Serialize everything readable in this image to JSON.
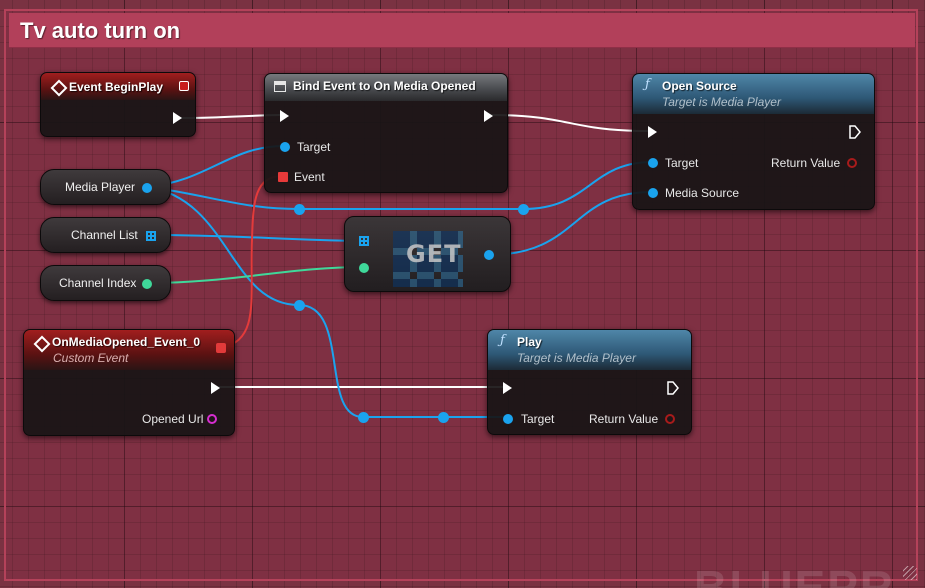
{
  "comment": {
    "title": "Tv auto turn on"
  },
  "watermark": "BLUEPR",
  "nodes": {
    "begin_play": {
      "title": "Event BeginPlay"
    },
    "bind_event": {
      "title": "Bind Event to On Media Opened",
      "pins": {
        "target": "Target",
        "event": "Event"
      }
    },
    "open_source": {
      "title": "Open Source",
      "subtitle": "Target is Media Player",
      "pins": {
        "target": "Target",
        "media_source": "Media Source",
        "return_value": "Return Value"
      }
    },
    "get": {
      "title": "GET"
    },
    "on_media_opened": {
      "title": "OnMediaOpened_Event_0",
      "subtitle": "Custom Event",
      "pins": {
        "opened_url": "Opened Url"
      }
    },
    "play": {
      "title": "Play",
      "subtitle": "Target is Media Player",
      "pins": {
        "target": "Target",
        "return_value": "Return Value"
      }
    }
  },
  "variables": {
    "media_player": "Media Player",
    "channel_list": "Channel List",
    "channel_index": "Channel Index"
  },
  "colors": {
    "graph_background": "#7a3242",
    "comment_header": "#b2405a",
    "object_pin": "#1aa3ee",
    "integer_pin": "#3fd89a",
    "delegate_pin": "#e13a3a",
    "string_pin": "#d72ed0",
    "exec_pin": "#ffffff"
  }
}
